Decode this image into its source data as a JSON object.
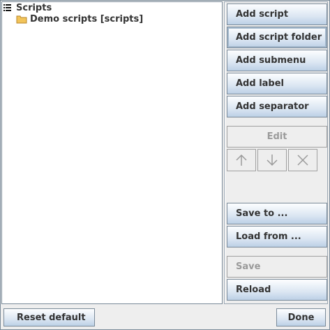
{
  "tree": {
    "root": {
      "label": "Scripts",
      "icon": "list-icon"
    },
    "children": [
      {
        "label": "Demo scripts [scripts]",
        "icon": "folder-icon"
      }
    ]
  },
  "actions": {
    "add_script": "Add script",
    "add_script_folder": "Add script folder",
    "add_submenu": "Add submenu",
    "add_label": "Add label",
    "add_separator": "Add separator",
    "edit": "Edit",
    "move_up_icon": "arrow-up-icon",
    "move_down_icon": "arrow-down-icon",
    "delete_icon": "close-icon",
    "save_to": "Save to ...",
    "load_from": "Load from ...",
    "save": "Save",
    "reload": "Reload"
  },
  "footer": {
    "reset_default": "Reset default",
    "done": "Done"
  },
  "colors": {
    "button_top": "#fdfeff",
    "button_bottom": "#bcd0e6",
    "border": "#7a8a99",
    "disabled_text": "#9a9a9a",
    "folder": "#f2c45a"
  }
}
